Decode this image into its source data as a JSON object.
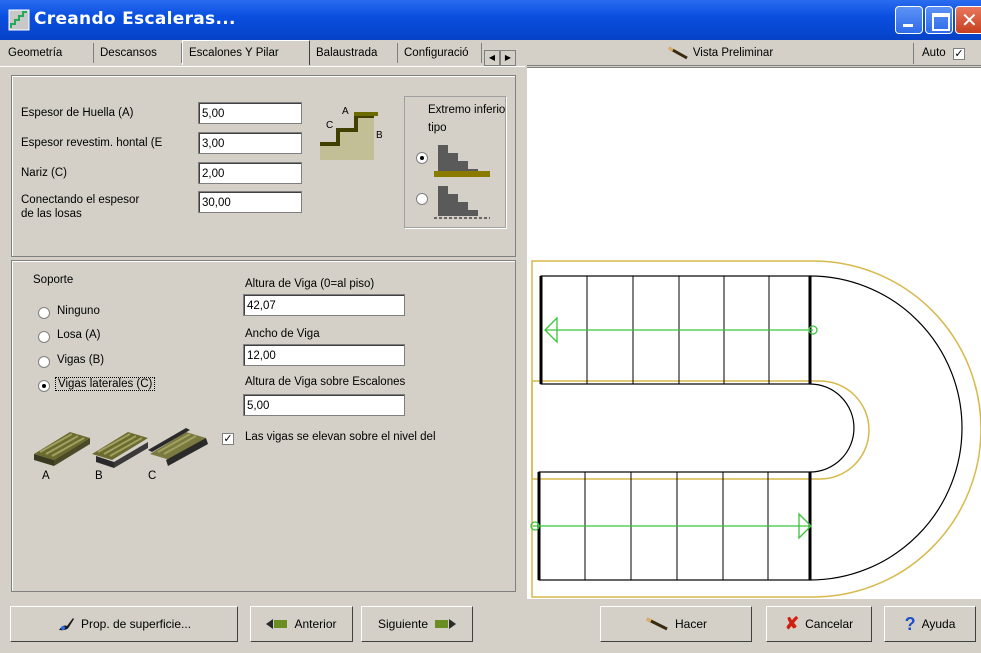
{
  "window": {
    "title": "Creando Escaleras..."
  },
  "tabs": [
    "Geometría",
    "Descansos",
    "Escalones Y Pilar",
    "Balaustrada",
    "Configuració"
  ],
  "preview_header": {
    "vista_label": "Vista Preliminar",
    "auto_label": "Auto",
    "auto_checked": true
  },
  "treads": {
    "fields": [
      {
        "label": "Espesor de Huella (A)",
        "value": "5,00"
      },
      {
        "label": "Espesor revestim. hontal (E",
        "value": "3,00"
      },
      {
        "label": "Nariz (C)",
        "value": "2,00"
      },
      {
        "label": "Conectando el espesor",
        "label2": "de las losas",
        "value": "30,00"
      }
    ],
    "bottom_end": {
      "title": "Extremo inferio",
      "title2": "tipo",
      "selected_index": 0
    }
  },
  "support": {
    "title": "Soporte",
    "options": [
      "Ninguno",
      "Losa (A)",
      "Vigas (B)",
      "Vigas laterales (C)"
    ],
    "selected_index": 3,
    "beam_height_floor": {
      "label": "Altura de Viga (0=al piso)",
      "value": "42,07"
    },
    "beam_width": {
      "label": "Ancho de Viga",
      "value": "12,00"
    },
    "beam_height_steps": {
      "label": "Altura de Viga sobre Escalones",
      "value": "5,00"
    },
    "raise_checkbox": {
      "label": "Las vigas se elevan sobre el nivel del",
      "checked": true
    },
    "type_labels": [
      "A",
      "B",
      "C"
    ]
  },
  "buttons": {
    "surface": "Prop. de superficie...",
    "prev": "Anterior",
    "next": "Siguiente",
    "make": "Hacer",
    "cancel": "Cancelar",
    "help": "Ayuda"
  },
  "colors": {
    "titlebar": "#0a4fe0",
    "dialog": "#d4d0c8",
    "stair_outline": "#d7b84a",
    "direction_arrow": "#3cc43c"
  }
}
